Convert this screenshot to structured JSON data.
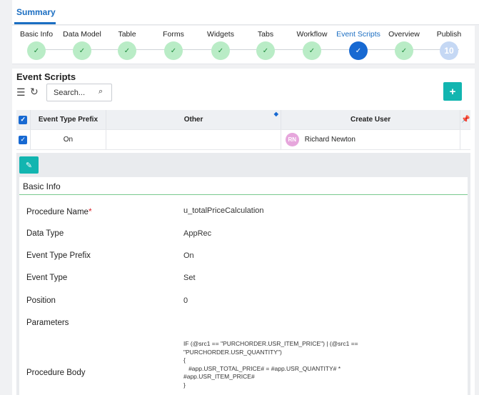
{
  "summary_tab": {
    "label": "Summary"
  },
  "steps": [
    {
      "label": "Basic Info",
      "state": "done",
      "mark": "✓"
    },
    {
      "label": "Data Model",
      "state": "done",
      "mark": "✓"
    },
    {
      "label": "Table",
      "state": "done",
      "mark": "✓"
    },
    {
      "label": "Forms",
      "state": "done",
      "mark": "✓"
    },
    {
      "label": "Widgets",
      "state": "done",
      "mark": "✓"
    },
    {
      "label": "Tabs",
      "state": "done",
      "mark": "✓"
    },
    {
      "label": "Workflow",
      "state": "done",
      "mark": "✓"
    },
    {
      "label": "Event Scripts",
      "state": "current",
      "mark": "✓"
    },
    {
      "label": "Overview",
      "state": "done",
      "mark": "✓"
    },
    {
      "label": "Publish",
      "state": "pending",
      "mark": "10"
    }
  ],
  "panel": {
    "title": "Event Scripts",
    "search_placeholder": "Search...",
    "add_label": "+"
  },
  "table": {
    "headers": {
      "prefix": "Event Type Prefix",
      "other": "Other",
      "user": "Create User"
    },
    "rows": [
      {
        "prefix": "On",
        "other": "",
        "user_initials": "RN",
        "user_name": "Richard Newton",
        "checked": true
      }
    ]
  },
  "detail": {
    "section_title": "Basic Info",
    "fields": {
      "procedure_name": {
        "label": "Procedure Name",
        "required_mark": "*",
        "value": "u_totalPriceCalculation"
      },
      "data_type": {
        "label": "Data Type",
        "value": "AppRec"
      },
      "event_type_prefix": {
        "label": "Event Type Prefix",
        "value": "On"
      },
      "event_type": {
        "label": "Event Type",
        "value": "Set"
      },
      "position": {
        "label": "Position",
        "value": "0"
      },
      "parameters": {
        "label": "Parameters",
        "value": ""
      },
      "procedure_body": {
        "label": "Procedure Body",
        "value": "IF (@src1 == \"PURCHORDER.USR_ITEM_PRICE\") | (@src1 ==\n\"PURCHORDER.USR_QUANTITY\")\n{\n   #app.USR_TOTAL_PRICE# = #app.USR_QUANTITY# *\n#app.USR_ITEM_PRICE#\n}"
      }
    }
  },
  "colors": {
    "accent": "#1769d2",
    "teal": "#12b5b0",
    "done": "#b9ecc6",
    "avatar": "#e6a6dc"
  }
}
